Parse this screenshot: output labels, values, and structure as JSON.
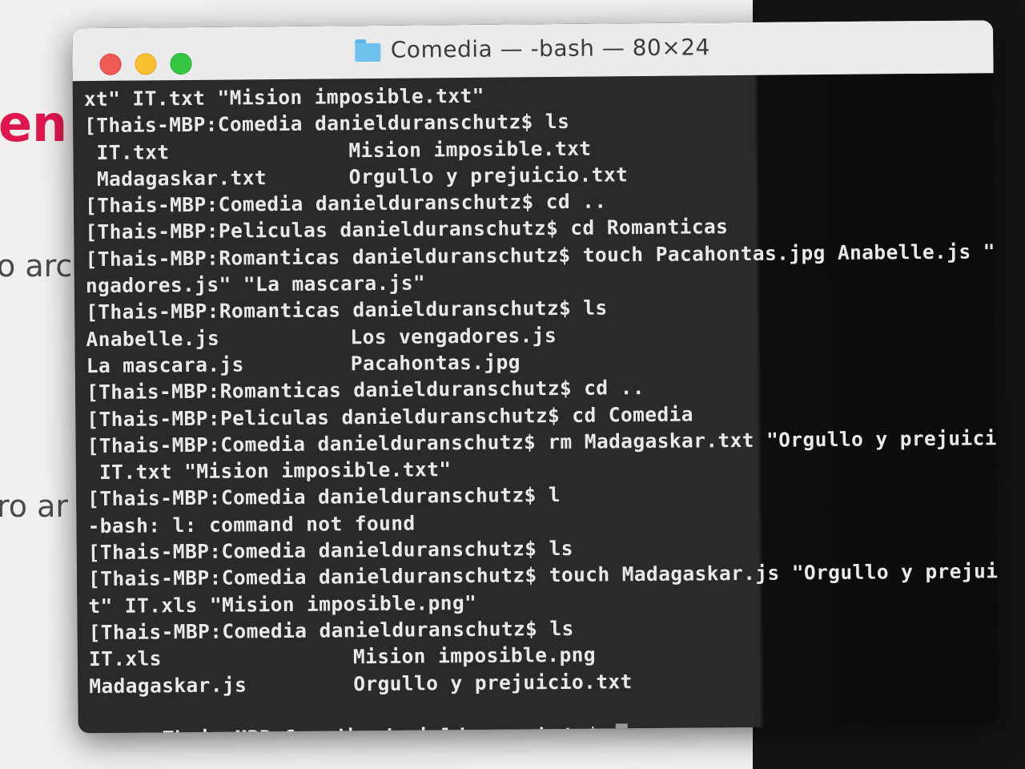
{
  "background": {
    "heading_fragment": "en c",
    "line1_fragment": "o arch",
    "line2_fragment": "ro ar"
  },
  "window": {
    "title": "Comedia — -bash — 80×24",
    "folder_icon": "folder-icon",
    "controls": [
      "close",
      "minimize",
      "maximize"
    ]
  },
  "terminal": {
    "lines": [
      {
        "text": "xt\" IT.txt \"Mision imposible.txt\"",
        "col2": ""
      },
      {
        "text": "[Thais-MBP:Comedia danielduranschutz$ ls",
        "col2": ""
      },
      {
        "text": " IT.txt",
        "col2": "Mision imposible.txt"
      },
      {
        "text": " Madagaskar.txt",
        "col2": "Orgullo y prejuicio.txt"
      },
      {
        "text": "[Thais-MBP:Comedia danielduranschutz$ cd ..",
        "col2": ""
      },
      {
        "text": "[Thais-MBP:Peliculas danielduranschutz$ cd Romanticas",
        "col2": ""
      },
      {
        "text": "[Thais-MBP:Romanticas danielduranschutz$ touch Pacahontas.jpg Anabelle.js \"Los ve",
        "col2": ""
      },
      {
        "text": "ngadores.js\" \"La mascara.js\"",
        "col2": ""
      },
      {
        "text": "[Thais-MBP:Romanticas danielduranschutz$ ls",
        "col2": ""
      },
      {
        "text": "Anabelle.js",
        "col2": "Los vengadores.js"
      },
      {
        "text": "La mascara.js",
        "col2": "Pacahontas.jpg"
      },
      {
        "text": "[Thais-MBP:Romanticas danielduranschutz$ cd ..",
        "col2": ""
      },
      {
        "text": "[Thais-MBP:Peliculas danielduranschutz$ cd Comedia",
        "col2": ""
      },
      {
        "text": "[Thais-MBP:Comedia danielduranschutz$ rm Madagaskar.txt \"Orgullo y prejuicio.txt\"",
        "col2": ""
      },
      {
        "text": " IT.txt \"Mision imposible.txt\"",
        "col2": ""
      },
      {
        "text": "[Thais-MBP:Comedia danielduranschutz$ l",
        "col2": ""
      },
      {
        "text": "-bash: l: command not found",
        "col2": ""
      },
      {
        "text": "[Thais-MBP:Comedia danielduranschutz$ ls",
        "col2": ""
      },
      {
        "text": "[Thais-MBP:Comedia danielduranschutz$ touch Madagaskar.js \"Orgullo y prejuicio.tx",
        "col2": ""
      },
      {
        "text": "t\" IT.xls \"Mision imposible.png\"",
        "col2": ""
      },
      {
        "text": "[Thais-MBP:Comedia danielduranschutz$ ls",
        "col2": ""
      },
      {
        "text": "IT.xls",
        "col2": "Mision imposible.png"
      },
      {
        "text": "Madagaskar.js",
        "col2": "Orgullo y prejuicio.txt"
      }
    ],
    "prompt": "Thais-MBP:Comedia danielduranschutz$ "
  }
}
